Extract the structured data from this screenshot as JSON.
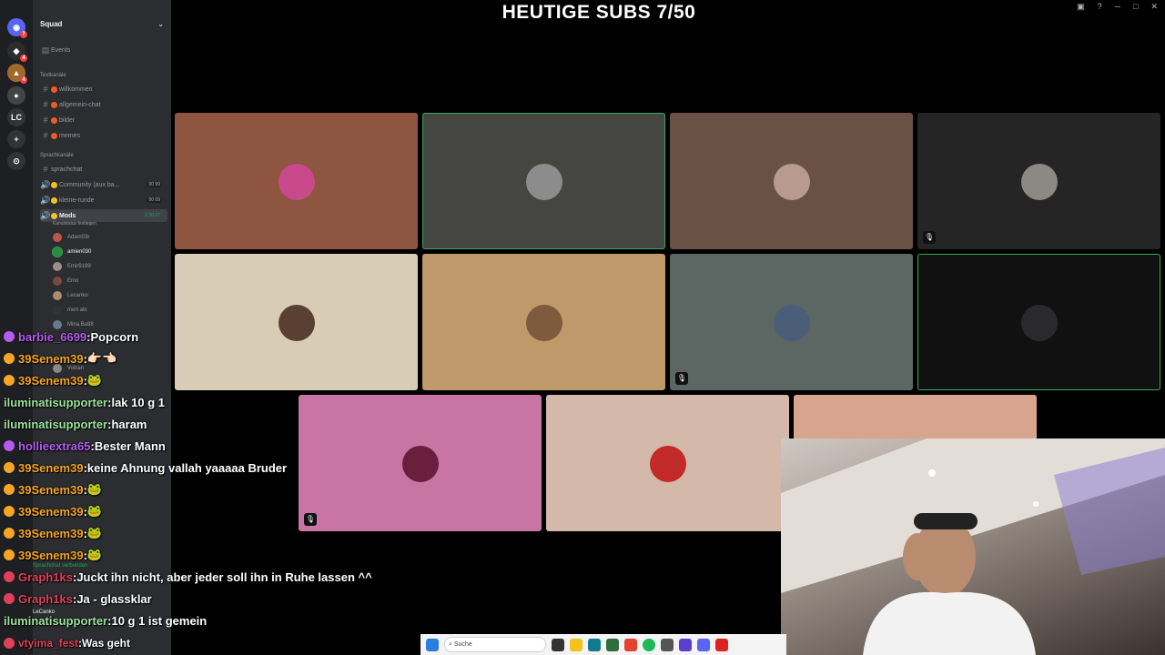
{
  "overlay_title": "HEUTIGE SUBS 7/50",
  "server": {
    "name": "Squad"
  },
  "rail": {
    "lc_label": "LC"
  },
  "sidebar": {
    "events_label": "Events",
    "text_category": "Textkanäle",
    "text_channels": [
      "willkommen",
      "allgemein-chat",
      "bilder",
      "memes"
    ],
    "voice_category": "Sprachkanäle",
    "voice_channels": [
      {
        "name": "sprachchat",
        "count": ""
      },
      {
        "name": "Community (aux ba...",
        "count": "00 99"
      },
      {
        "name": "kleine-runde",
        "count": "00 09"
      },
      {
        "name": "Mods",
        "count": "2:30:27",
        "status": "Kanalstatus festlegen"
      }
    ],
    "members": [
      "Adam03r",
      "amien030",
      "Emir9199",
      "Emo",
      "Lecanko",
      "mert abi",
      "Mina.Ba98",
      "Volkan"
    ],
    "voice_connected": "Sprachchat verbunden",
    "user": "LeCanko"
  },
  "tiles": [
    {
      "bg": "#8e5540",
      "avatar": "#c94a8b",
      "muted": false,
      "active": false
    },
    {
      "bg": "#454542",
      "avatar": "#8c8c8c",
      "muted": false,
      "active": true
    },
    {
      "bg": "#6a5146",
      "avatar": "#b89a8e",
      "muted": false,
      "active": false
    },
    {
      "bg": "#252525",
      "avatar": "#8c8884",
      "muted": true,
      "active": false
    },
    {
      "bg": "#d9ccb6",
      "avatar": "#5a4032",
      "muted": false,
      "active": false
    },
    {
      "bg": "#c0996b",
      "avatar": "#7d5b3c",
      "muted": false,
      "active": false
    },
    {
      "bg": "#5c6763",
      "avatar": "#4a5e7a",
      "muted": true,
      "active": false
    },
    {
      "bg": "#111111",
      "avatar": "#2a2a2e",
      "muted": false,
      "active": true
    },
    {
      "bg": "#c975a4",
      "avatar": "#6b1f3e",
      "muted": true,
      "active": false
    },
    {
      "bg": "#d4b8aa",
      "avatar": "#c22a2a",
      "muted": false,
      "active": false
    },
    {
      "bg": "#d8a48e",
      "avatar": "",
      "muted": false,
      "active": false
    }
  ],
  "chat": [
    {
      "user": "barbie_6699",
      "sep": " : ",
      "text": "Popcorn",
      "color": "#b45cf0"
    },
    {
      "user": "39Senem39",
      "sep": " : ",
      "text": "👉🏻👈🏻",
      "color": "#f5a623"
    },
    {
      "user": "39Senem39",
      "sep": " : ",
      "text": "🐸",
      "color": "#f5a623"
    },
    {
      "user": "iluminatisupporter",
      "sep": " : ",
      "text": "lak 10 g 1",
      "color": "#9be39b"
    },
    {
      "user": "iluminatisupporter",
      "sep": " : ",
      "text": "haram",
      "color": "#9be39b"
    },
    {
      "user": "hollieextra65",
      "sep": " : ",
      "text": "Bester Mann",
      "color": "#b45cf0"
    },
    {
      "user": "39Senem39",
      "sep": " : ",
      "text": "keine Ahnung vallah yaaaaa Bruder",
      "color": "#f5a623"
    },
    {
      "user": "39Senem39",
      "sep": " : ",
      "text": "🐸",
      "color": "#f5a623"
    },
    {
      "user": "39Senem39",
      "sep": " : ",
      "text": "🐸",
      "color": "#f5a623"
    },
    {
      "user": "39Senem39",
      "sep": " : ",
      "text": "🐸",
      "color": "#f5a623"
    },
    {
      "user": "39Senem39",
      "sep": " : ",
      "text": "🐸",
      "color": "#f5a623"
    },
    {
      "user": "Graph1ks",
      "sep": " : ",
      "text": "Juckt ihn nicht, aber jeder soll ihn in Ruhe lassen ^^",
      "color": "#e0405a"
    },
    {
      "user": "Graph1ks",
      "sep": " : ",
      "text": "Ja - glassklar",
      "color": "#e0405a"
    },
    {
      "user": "iluminatisupporter",
      "sep": " : ",
      "text": "10 g 1 ist gemein",
      "color": "#9be39b"
    },
    {
      "user": "vtyima_fest",
      "sep": " : ",
      "text": "Was geht",
      "color": "#e0405a"
    }
  ],
  "taskbar": {
    "search_placeholder": "Suche"
  }
}
